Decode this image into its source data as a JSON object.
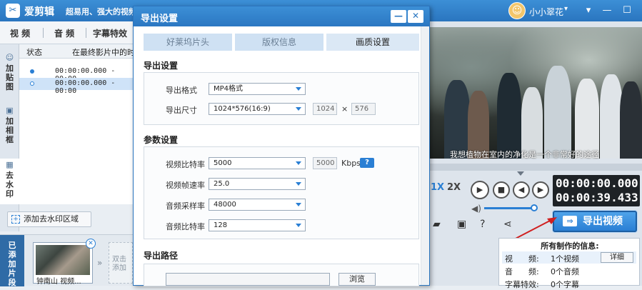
{
  "app": {
    "name": "爱剪辑",
    "slogan": "超易用、强大的视频剪辑软件",
    "user": "小小翠花",
    "logo_glyph": "✂",
    "avatar_glyph": "☺"
  },
  "window_controls": {
    "menu": "▾",
    "minimize": "—",
    "maximize": "☐",
    "close": "✕"
  },
  "top_tabs": [
    "视 频",
    "音 频",
    "字幕特效"
  ],
  "side_nav": [
    {
      "icon": "☺",
      "label": "加贴图"
    },
    {
      "icon": "▣",
      "label": "加相框"
    },
    {
      "icon": "▦",
      "label": "去水印"
    }
  ],
  "track_list": {
    "headers": [
      "状态",
      "在最终影片中的时"
    ],
    "rows": [
      {
        "time": "00:00:00.000 - 00:00"
      },
      {
        "time": "00:00:00.000 - 00:00"
      }
    ]
  },
  "add_watermark_btn": "添加去水印区域",
  "clips": {
    "label": "已添加片段",
    "items": [
      {
        "title": "钟南山 视频..."
      }
    ],
    "drop_hint": "双击添加"
  },
  "preview": {
    "subtitle": "我想植物在室内的净化是一个非常好的途径",
    "speed_options": [
      "1X",
      "2X"
    ],
    "current_time": "00:00:00.000",
    "total_time": "00:00:39.433",
    "volume": 0.95
  },
  "export_button": "导出视频",
  "info_panel": {
    "title": "所有制作的信息:",
    "rows": [
      {
        "key": "视　　频:",
        "value": "1个视频",
        "action": "详细"
      },
      {
        "key": "音　　频:",
        "value": "0个音频"
      },
      {
        "key": "字幕特效:",
        "value": "0个字幕"
      }
    ]
  },
  "dialog": {
    "title": "导出设置",
    "tabs": [
      "好莱坞片头",
      "版权信息",
      "画质设置"
    ],
    "active_tab": 2,
    "export_section": {
      "title": "导出设置",
      "format_label": "导出格式",
      "format_value": "MP4格式",
      "size_label": "导出尺寸",
      "size_value": "1024*576(16:9)",
      "width": "1024",
      "height": "576",
      "times": "×"
    },
    "param_section": {
      "title": "参数设置",
      "video_bitrate_label": "视频比特率",
      "video_bitrate_value": "5000",
      "video_bitrate_display": "5000",
      "bitrate_unit": "Kbps",
      "help": "?",
      "frame_rate_label": "视频帧速率",
      "frame_rate_value": "25.0",
      "audio_sample_label": "音频采样率",
      "audio_sample_value": "48000",
      "audio_bitrate_label": "音频比特率",
      "audio_bitrate_value": "128"
    },
    "path_section": {
      "title": "导出路径",
      "path_value": "",
      "browse": "浏览"
    }
  },
  "colors": {
    "accent": "#2a7fd4",
    "titlebar": "#2a75bf",
    "timecode_bg": "#1e2226",
    "arrow": "#d02020"
  },
  "icons": [
    "scissors-logo-icon",
    "avatar-icon",
    "play-icon",
    "stop-icon",
    "prev-frame-icon",
    "next-frame-icon",
    "volume-icon",
    "folder-icon",
    "save-icon",
    "help-icon",
    "share-icon",
    "export-icon"
  ]
}
